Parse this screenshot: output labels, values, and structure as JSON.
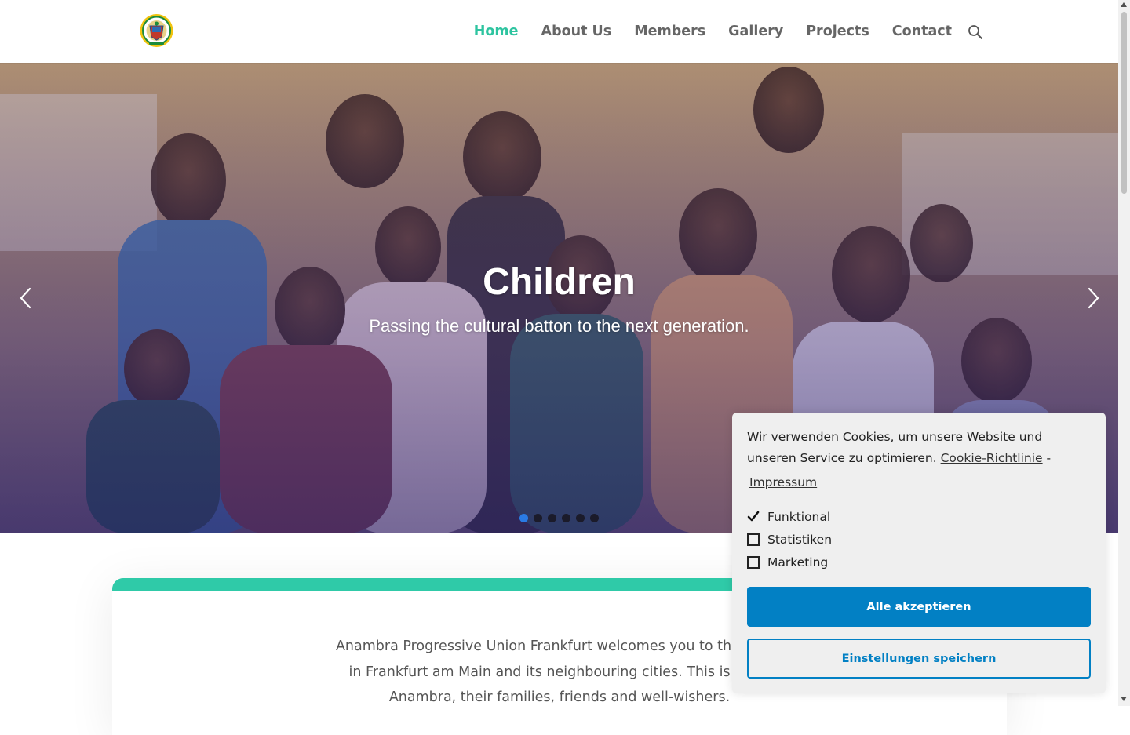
{
  "header": {
    "logo_icon": "apu-emblem-logo",
    "nav": [
      {
        "label": "Home",
        "active": true
      },
      {
        "label": "About Us",
        "active": false
      },
      {
        "label": "Members",
        "active": false
      },
      {
        "label": "Gallery",
        "active": false
      },
      {
        "label": "Projects",
        "active": false
      },
      {
        "label": "Contact",
        "active": false
      }
    ],
    "search_icon": "search-icon",
    "accent_color": "#2ec4a0"
  },
  "hero": {
    "title": "Children",
    "subtitle": "Passing the cultural batton to the next generation.",
    "prev_icon": "chevron-left-icon",
    "next_icon": "chevron-right-icon",
    "slide_count": 6,
    "active_slide": 1
  },
  "intro": {
    "line1": "Anambra Progressive Union Frankfurt welcomes you to the home",
    "line2": "in Frankfurt am Main and its neighbouring cities. This is the h",
    "line3": "Anambra, their families, friends and well-wishers.",
    "accent_color": "#2fcaa8"
  },
  "cookie": {
    "message": "Wir verwenden Cookies, um unsere Website und unseren Service zu optimieren.",
    "policy_link": "Cookie-Richtlinie",
    "separator": "-",
    "impressum_link": "Impressum",
    "options": [
      {
        "label": "Funktional",
        "checked": true
      },
      {
        "label": "Statistiken",
        "checked": false
      },
      {
        "label": "Marketing",
        "checked": false
      }
    ],
    "accept_label": "Alle akzeptieren",
    "save_label": "Einstellungen speichern",
    "button_color": "#0280c4"
  }
}
